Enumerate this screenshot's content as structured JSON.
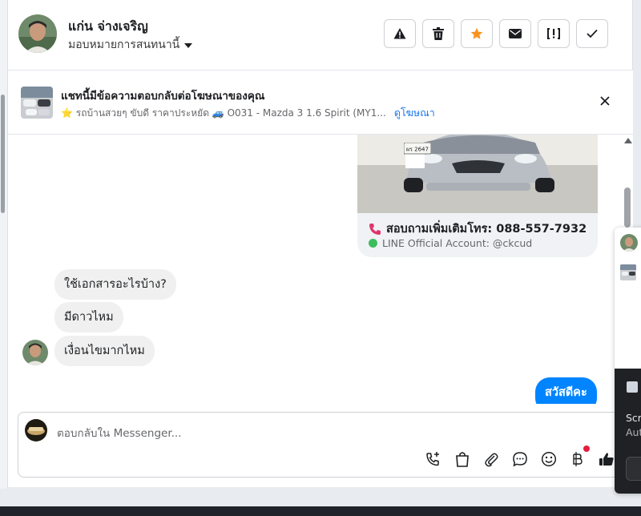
{
  "header": {
    "contact_name": "แก่น จ่างเจริญ",
    "assign_label": "มอบหมายการสนทนานี้",
    "actions": [
      {
        "name": "report-button",
        "icon": "warning-icon"
      },
      {
        "name": "delete-button",
        "icon": "trash-icon"
      },
      {
        "name": "star-button",
        "icon": "star-icon",
        "color": "#f7931e"
      },
      {
        "name": "mark-unread-button",
        "icon": "envelope-icon"
      },
      {
        "name": "follow-up-button",
        "icon": "follow-up-icon"
      },
      {
        "name": "mark-done-button",
        "icon": "check-icon"
      }
    ]
  },
  "ad_banner": {
    "title": "แชทนี้มีข้อความตอบกลับต่อโฆษณาของคุณ",
    "description": "⭐ รถบ้านสวยๆ ขับดี ราคาประหยัด 🚙 O031 - Mazda 3 1.6 Spirit (MY1...",
    "link_label": "ดูโฆษณา"
  },
  "chat": {
    "card": {
      "plate_text": "ผร 2647",
      "call_text": "สอบถามเพิ่มเติมโทร: 088-557-7932",
      "line_text": "LINE Official Account: @ckcud"
    },
    "incoming_messages": [
      "ใช้เอกสารอะไรบ้าง?",
      "มีดาวไหม",
      "เงื่อนไขมากไหม"
    ],
    "outgoing_message": "สวัสดีคะ"
  },
  "composer": {
    "placeholder": "ตอบกลับใน Messenger..."
  },
  "popup": {
    "text_1": "Scr",
    "text_2": "Aut"
  },
  "colors": {
    "accent": "#1877f2",
    "outgoing_bubble": "#0084ff",
    "star": "#f7931e"
  }
}
